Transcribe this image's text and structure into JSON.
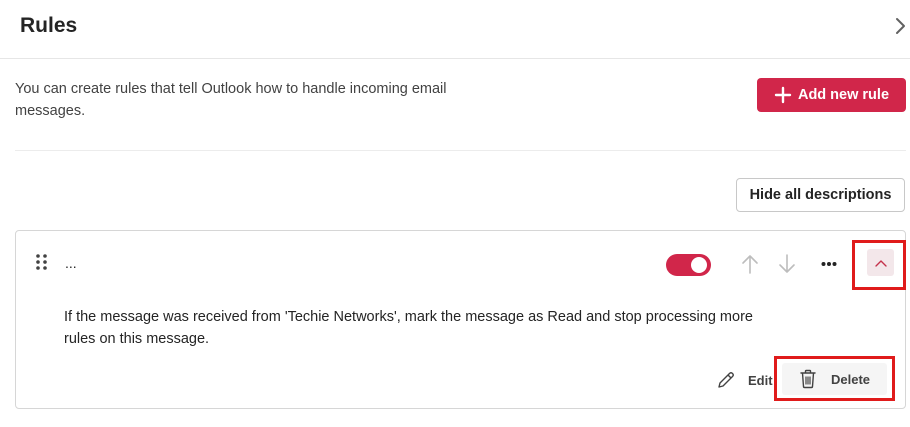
{
  "header": {
    "title": "Rules"
  },
  "intro": {
    "description": "You can create rules that tell Outlook how to handle incoming email messages."
  },
  "actions": {
    "add_rule_label": "Add new rule",
    "hide_descriptions_label": "Hide all descriptions"
  },
  "rule": {
    "name": "...",
    "enabled": true,
    "description": "If the message was received from 'Techie Networks', mark the message as Read and stop processing more rules on this message.",
    "edit_label": "Edit",
    "delete_label": "Delete"
  },
  "colors": {
    "accent": "#d1264a",
    "highlight": "#e01b1b"
  }
}
